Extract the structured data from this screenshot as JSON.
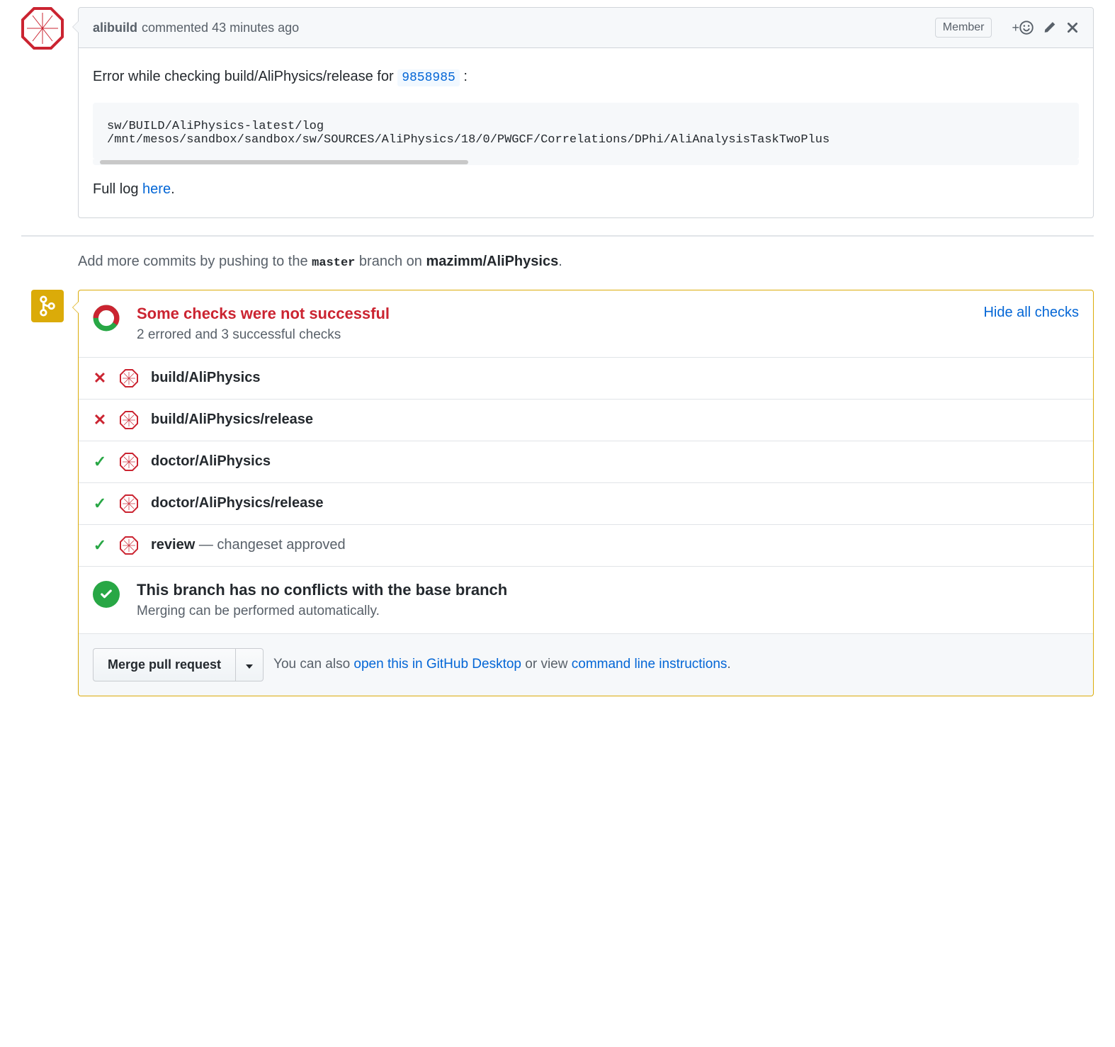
{
  "comment": {
    "author": "alibuild",
    "verb": "commented",
    "time": "43 minutes ago",
    "badge": "Member",
    "body_prefix": "Error while checking build/AliPhysics/release for ",
    "commit_sha": "9858985",
    "body_suffix": " :",
    "code_line1": "sw/BUILD/AliPhysics-latest/log",
    "code_line2": "/mnt/mesos/sandbox/sandbox/sw/SOURCES/AliPhysics/18/0/PWGCF/Correlations/DPhi/AliAnalysisTaskTwoPlus",
    "fulllog_prefix": "Full log ",
    "fulllog_link": "here",
    "fulllog_suffix": "."
  },
  "hint": {
    "pre": "Add more commits by pushing to the ",
    "branch": "master",
    "mid": " branch on ",
    "repo": "mazimm/AliPhysics",
    "post": "."
  },
  "checks": {
    "title": "Some checks were not successful",
    "subtitle": "2 errored and 3 successful checks",
    "toggle": "Hide all checks",
    "items": [
      {
        "status": "fail",
        "name": "build/AliPhysics",
        "note": ""
      },
      {
        "status": "fail",
        "name": "build/AliPhysics/release",
        "note": ""
      },
      {
        "status": "pass",
        "name": "doctor/AliPhysics",
        "note": ""
      },
      {
        "status": "pass",
        "name": "doctor/AliPhysics/release",
        "note": ""
      },
      {
        "status": "pass",
        "name": "review",
        "note": " — changeset approved"
      }
    ]
  },
  "conflict": {
    "title": "This branch has no conflicts with the base branch",
    "subtitle": "Merging can be performed automatically."
  },
  "merge": {
    "button": "Merge pull request",
    "text_pre": "You can also ",
    "link1": "open this in GitHub Desktop",
    "text_mid": " or view ",
    "link2": "command line instructions",
    "text_post": "."
  }
}
